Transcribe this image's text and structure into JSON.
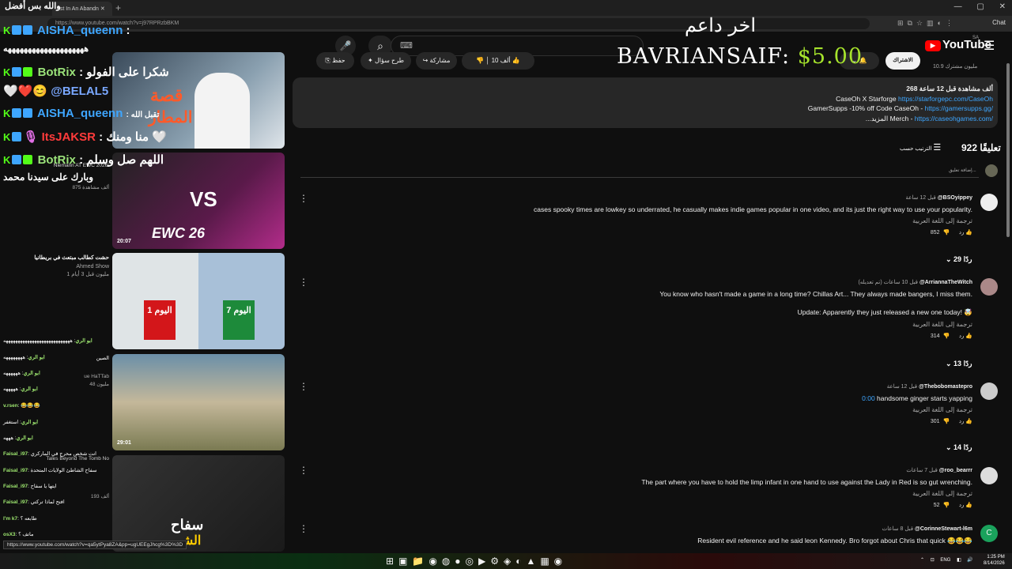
{
  "browser": {
    "first_tab_title": "والله بس أفضل",
    "tab_title": "ost In An Abandn",
    "url": "https://www.youtube.com/watch?v=j97RPRzbBKM",
    "chat_label": "Chat",
    "status_url": "https://www.youtube.com/watch?v=qa5ytPya8ZA&pp=ugUEEgJhcg%3D%3D"
  },
  "header": {
    "logo_text": "YouTube",
    "country_code": "SA",
    "search_kbd": "⌨"
  },
  "actions": {
    "subscribe": "الاشتراك",
    "subscribers": "10.9 مليون مشترك",
    "like_count": "10 ألف",
    "share": "مشاركة",
    "ask": "طرح سؤال",
    "save": "حفظ"
  },
  "donation": {
    "title": "اخر داعم",
    "name": "BAVRIANSAIF:",
    "amount": "$5.00"
  },
  "description": {
    "line1": "268 ألف مشاهدة  قبل 12 ساعة",
    "line2_text": "CaseOh X Starforge ",
    "line2_link": "https://starforgepc.com/CaseOh",
    "line3_text": "GamerSupps -10% off Code CaseOh - ",
    "line3_link": "https://gamersupps.gg/",
    "line4_text": "...المزيد    Merch - ",
    "line4_link": "https://caseohgames.com/"
  },
  "comments_header": {
    "count": "922 تعليقًا",
    "sort": "الترتيب حسب",
    "add_placeholder": "إضافة تعليق..."
  },
  "comments": [
    {
      "author": "@BSOyippey",
      "time": "قبل 12 ساعة",
      "lines": [
        "cases spooky times are lowkey so underrated, he casually makes indie games popular in one video, and its just the right way to use your popularity."
      ],
      "translate": "ترجمة إلى اللغة العربية",
      "likes": "852",
      "reply": "رد",
      "replies": "29 ردًا"
    },
    {
      "author": "@ArriannaTheWitch",
      "time": "قبل 10 ساعات (تم تعديله)",
      "lines": [
        "You know who hasn't made a game in a long time? Chillas Art... They always made bangers, I miss them.",
        "Update: Apparently they just released a new one today! 🤯"
      ],
      "translate": "ترجمة إلى اللغة العربية",
      "likes": "314",
      "reply": "رد",
      "replies": "13 ردًا"
    },
    {
      "author": "@Thebobomastepro",
      "time": "قبل 12 ساعة",
      "timestamp": "0:00",
      "lines": [
        " handsome ginger starts yapping"
      ],
      "translate": "ترجمة إلى اللغة العربية",
      "likes": "301",
      "reply": "رد",
      "replies": "14 ردًا"
    },
    {
      "author": "@roo_bearrr",
      "time": "قبل 7 ساعات",
      "lines": [
        "The part where you have to hold the limp infant in one hand to use against the Lady in Red is so gut wrenching."
      ],
      "translate": "ترجمة إلى اللغة العربية",
      "likes": "52",
      "reply": "رد"
    },
    {
      "author": "@CorinneStewart-l6m",
      "time": "قبل 8 ساعات",
      "lines": [
        "Resident evil reference and he said leon Kennedy. Bro forgot about Chris that quick 😂😂😂"
      ]
    }
  ],
  "thumbnails": [
    {
      "text1": "قصة",
      "text2": "المطار",
      "duration": ""
    },
    {
      "text1": "VS",
      "text2": "EWC 26",
      "duration": "20:07"
    },
    {
      "text1": "اليوم 1",
      "text2": "اليوم 7",
      "duration": ""
    },
    {
      "text1": "",
      "text2": "",
      "duration": "29:01"
    },
    {
      "text1": "سفاح",
      "text2": "الشـ",
      "duration": ""
    }
  ],
  "sidebar_meta": [
    {
      "title": "Niemann AT EWC 2026!",
      "channel": "",
      "meta": "875 ألف مشاهدة"
    },
    {
      "title": "حشت كطالب مبتعث في بريطانيا",
      "channel": "Ahmed Show",
      "meta": "1 مليون  قبل 3 أيام"
    },
    {
      "title": "الصين",
      "channel": "ue HaTTab",
      "meta": "48 مليون"
    },
    {
      "title": "Tales Beyond The Tomb No",
      "channel": "",
      "meta": "193 ألف"
    }
  ],
  "chat": [
    {
      "user": "AISHA_queenn",
      "msg": ":",
      "color": "#3ea6ff"
    },
    {
      "user": "",
      "msg": "ههههههههههههههههههههه",
      "color": "#ffffff"
    },
    {
      "user": "BotRix",
      "msg": ": شكرا على الفولو",
      "color": "#9be37a"
    },
    {
      "user": "@BELAL5",
      "msg": "🤍❤️😊",
      "color": "#7aa8ff"
    },
    {
      "user": "AISHA_queenn",
      "msg": ": تقبل الله",
      "color": "#3ea6ff"
    },
    {
      "user": "ItsJAKSR",
      "msg": ": منا ومنك 🤍",
      "color": "#ff3b3b"
    },
    {
      "user": "BotRix",
      "msg": ": اللهم صل وسلم",
      "color": "#9be37a"
    },
    {
      "user": "",
      "msg": "وبارك على سيدنا محمد",
      "color": "#ffffff"
    }
  ],
  "chat_small": [
    {
      "user": "ابو الري",
      "msg": ": ههههههههههههههههههههههههههههه"
    },
    {
      "user": "ابو الري",
      "msg": ": ههههههههه"
    },
    {
      "user": "ابو الري",
      "msg": ": ههههههه"
    },
    {
      "user": "ابو الري",
      "msg": ": هههههه"
    },
    {
      "user": "v.rsen",
      "msg": ": 😂😂😂"
    },
    {
      "user": "ابو الري",
      "msg": ": استغفر"
    },
    {
      "user": "ابو الري",
      "msg": ": هههه"
    },
    {
      "user": "Faisal_i97",
      "msg": ": انت شخص محرج في الماركري"
    },
    {
      "user": "Faisal_i97",
      "msg": ": سفاح الشاطئ الولايات المتحدة"
    },
    {
      "user": "Faisal_i97",
      "msg": ": ايتها يا سفاح"
    },
    {
      "user": "Faisal_i97",
      "msg": ": افتح لماذا تركتي"
    },
    {
      "user": "l'm k7",
      "msg": ": طابعه ؟"
    },
    {
      "user": "osX3",
      "msg": ": ماتف ؟"
    }
  ],
  "taskbar": {
    "lang": "ENG",
    "time": "1:25 PM",
    "date": "8/14/2026"
  }
}
